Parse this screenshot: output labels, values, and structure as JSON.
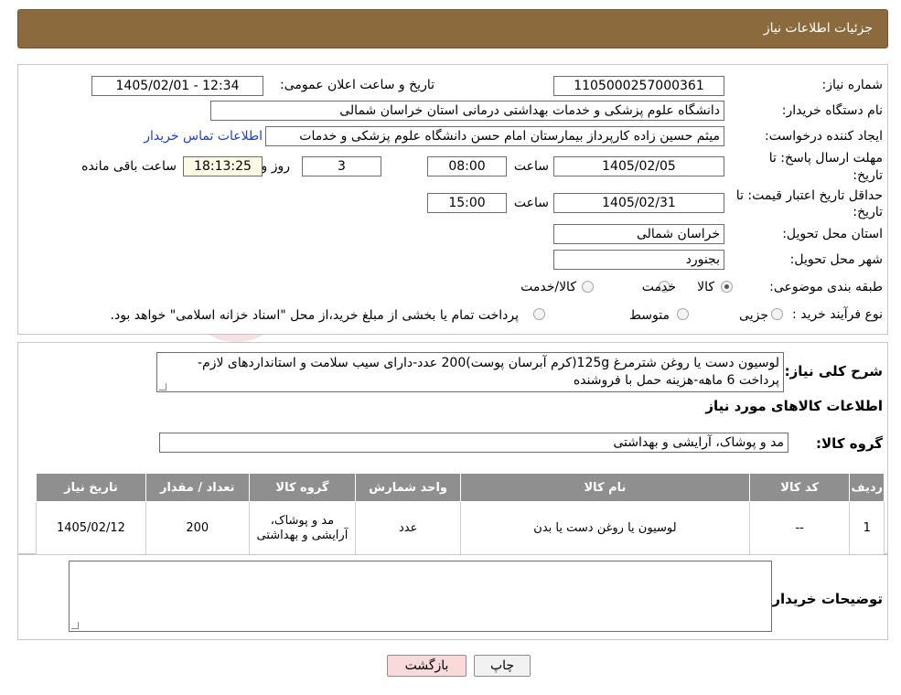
{
  "header": {
    "title": "جزئیات اطلاعات نیاز"
  },
  "fields": {
    "need_number_label": "شماره نیاز:",
    "need_number": "1105000257000361",
    "announce_label": "تاریخ و ساعت اعلان عمومی:",
    "announce_value": "1405/02/01 - 12:34",
    "buyer_org_label": "نام دستگاه خریدار:",
    "buyer_org": "دانشگاه علوم پزشکی و خدمات بهداشتی درمانی استان خراسان شمالی",
    "requester_label": "ایجاد کننده درخواست:",
    "requester": "میثم  حسین زاده  کارپرداز بیمارستان امام حسن دانشگاه علوم پزشکی و خدمات",
    "contact_link": "اطلاعات تماس خریدار",
    "deadline_label_1": "مهلت ارسال پاسخ: تا",
    "deadline_label_2": "تاریخ:",
    "deadline_date": "1405/02/05",
    "time_word": "ساعت",
    "deadline_time": "08:00",
    "days_value": "3",
    "days_word": "روز و",
    "remaining_time": "18:13:25",
    "remaining_word": "ساعت باقی مانده",
    "validity_label_1": "حداقل تاریخ اعتبار قیمت: تا",
    "validity_label_2": "تاریخ:",
    "validity_date": "1405/02/31",
    "validity_time": "15:00",
    "province_label": "استان محل تحویل:",
    "province": "خراسان شمالی",
    "city_label": "شهر محل تحویل:",
    "city": "بجنورد",
    "category_label": "طبقه بندی موضوعی:",
    "category_options": [
      "کالا",
      "خدمت",
      "کالا/خدمت"
    ],
    "category_selected": "کالا",
    "process_label": "نوع فرآیند خرید :",
    "process_options": [
      "جزیی",
      "متوسط"
    ],
    "payment_note": "پرداخت تمام یا بخشی از مبلغ خرید،از محل \"اسناد خزانه اسلامی\" خواهد بود."
  },
  "summary": {
    "label": "شرح کلی نیاز:",
    "text": "لوسیون دست یا روغن شترمرغ 125g(کرم آبرسان پوست)200 عدد-دارای سیب سلامت و استانداردهای لازم-پرداخت 6 ماهه-هزینه حمل با فروشنده"
  },
  "goods": {
    "section_title": "اطلاعات کالاهای مورد نیاز",
    "group_label": "گروه کالا:",
    "group_value": "مد و پوشاک، آرایشی و بهداشتی"
  },
  "table": {
    "headers": [
      "ردیف",
      "کد کالا",
      "نام کالا",
      "واحد شمارش",
      "گروه کالا",
      "تعداد / مقدار",
      "تاریخ نیاز"
    ],
    "rows": [
      [
        "1",
        "--",
        "لوسیون یا روغن دست یا بدن",
        "عدد",
        "مد و پوشاک، آرایشی و بهداشتی",
        "200",
        "1405/02/12"
      ]
    ]
  },
  "notes": {
    "label": "توضیحات خریدار:",
    "value": ""
  },
  "buttons": {
    "print": "چاپ",
    "back": "بازگشت"
  },
  "watermark": {
    "text": "AriaTender.neT"
  },
  "colors": {
    "header_bg": "#8b6b3e",
    "table_header_bg": "#8f8f8f",
    "back_button_bg": "#f9d9d9",
    "link": "#1f3fbf"
  }
}
